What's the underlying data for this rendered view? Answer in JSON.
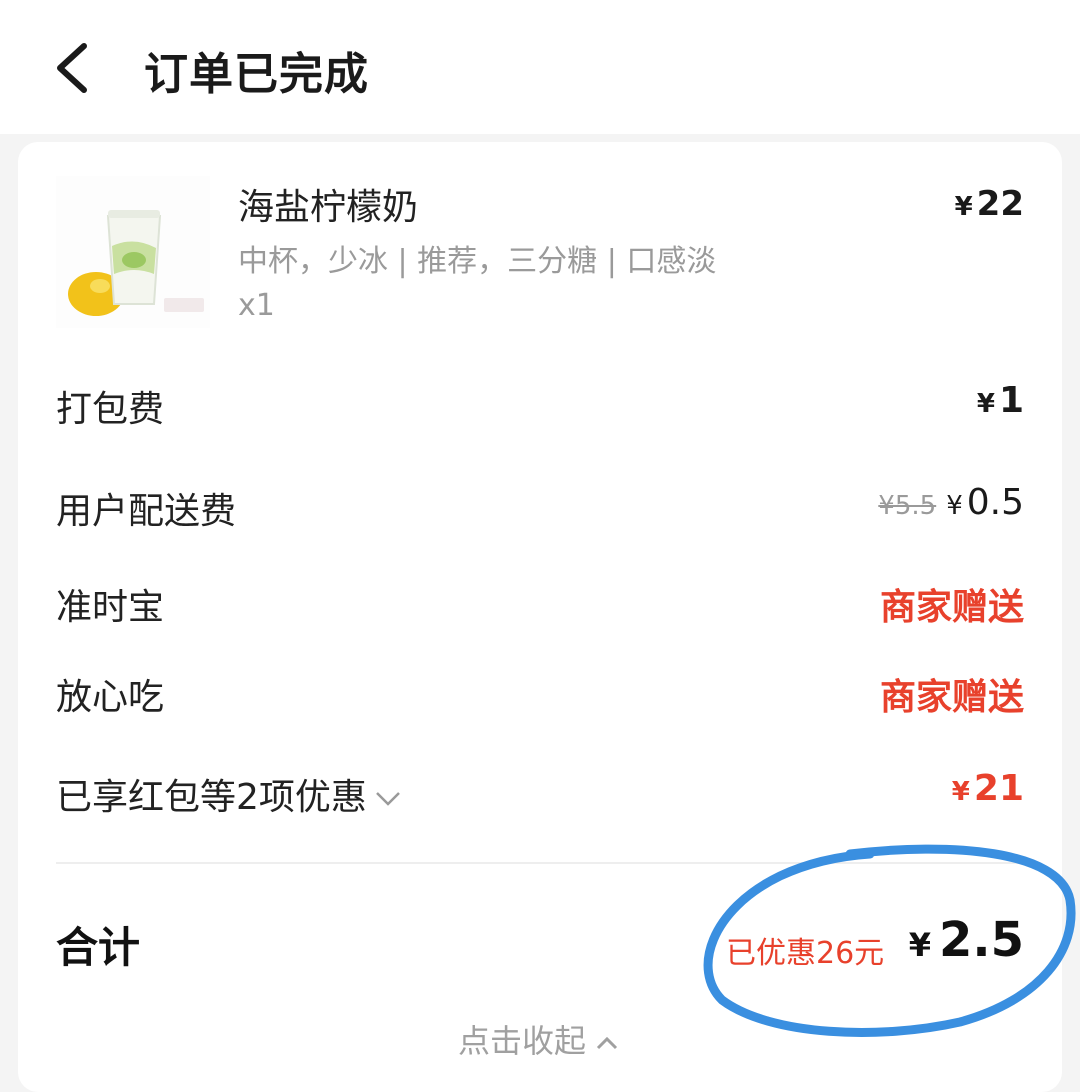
{
  "header": {
    "title": "订单已完成"
  },
  "item": {
    "name": "海盐柠檬奶",
    "spec": "中杯，少冰 | 推荐，三分糖 | 口感淡",
    "qty": "x1",
    "currency": "¥",
    "price": "22"
  },
  "fees": {
    "packing": {
      "label": "打包费",
      "currency": "¥",
      "value": "1"
    },
    "delivery": {
      "label": "用户配送费",
      "original": "¥5.5",
      "currency": "¥",
      "value": "0.5"
    },
    "ontime": {
      "label": "准时宝",
      "value": "商家赠送"
    },
    "safe": {
      "label": "放心吃",
      "value": "商家赠送"
    },
    "discount": {
      "label": "已享红包等2项优惠",
      "currency": "¥",
      "value": "21"
    }
  },
  "total": {
    "label": "合计",
    "saved": "已优惠26元",
    "currency": "¥",
    "value": "2.5"
  },
  "collapse": {
    "label": "点击收起"
  },
  "colors": {
    "accent_red": "#e8412c",
    "annotation_blue": "#3a8fe0"
  }
}
